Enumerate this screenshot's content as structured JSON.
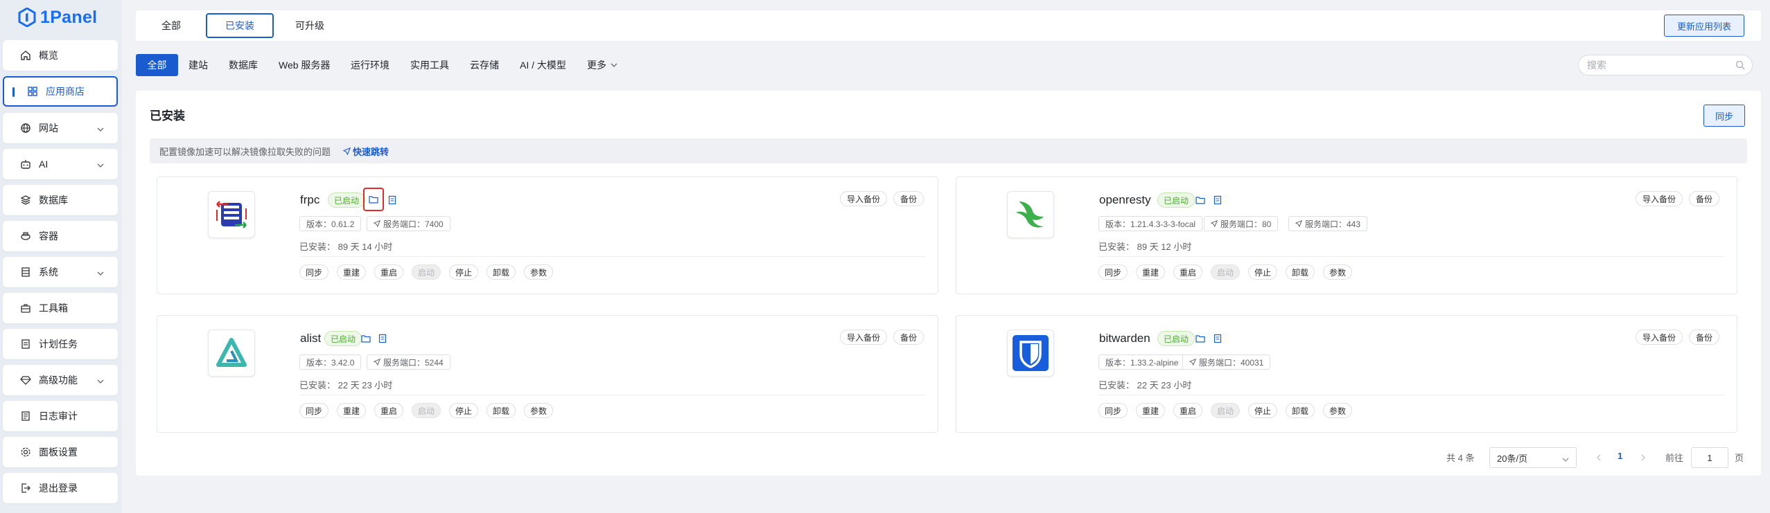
{
  "brand": {
    "name": "1Panel",
    "color": "#1a6df0"
  },
  "sidebar": {
    "items": [
      {
        "label": "概览",
        "icon": "home-icon"
      },
      {
        "label": "应用商店",
        "icon": "grid-icon",
        "active": true
      },
      {
        "label": "网站",
        "icon": "globe-icon",
        "expandable": true
      },
      {
        "label": "AI",
        "icon": "robot-icon",
        "expandable": true
      },
      {
        "label": "数据库",
        "icon": "layers-icon"
      },
      {
        "label": "容器",
        "icon": "container-icon"
      },
      {
        "label": "系统",
        "icon": "server-icon",
        "expandable": true
      },
      {
        "label": "工具箱",
        "icon": "toolbox-icon"
      },
      {
        "label": "计划任务",
        "icon": "calendar-icon"
      },
      {
        "label": "高级功能",
        "icon": "diamond-icon",
        "expandable": true
      },
      {
        "label": "日志审计",
        "icon": "log-icon"
      },
      {
        "label": "面板设置",
        "icon": "gear-icon"
      },
      {
        "label": "退出登录",
        "icon": "logout-icon"
      }
    ]
  },
  "tabs": [
    {
      "label": "全部"
    },
    {
      "label": "已安装",
      "active": true
    },
    {
      "label": "可升级"
    }
  ],
  "update_list_label": "更新应用列表",
  "categories": [
    "全部",
    "建站",
    "数据库",
    "Web 服务器",
    "运行环境",
    "实用工具",
    "云存储",
    "AI / 大模型",
    "更多"
  ],
  "search": {
    "placeholder": "搜索"
  },
  "panel": {
    "title": "已安装",
    "sync_label": "同步",
    "notice": "配置镜像加速可以解决镜像拉取失败的问题",
    "notice_link": "快速跳转"
  },
  "apps": [
    {
      "name": "frpc",
      "status": "已启动",
      "version": "版本：0.61.2",
      "ports": [
        "服务端口：7400"
      ],
      "installed": "已安装：  89 天 14 小时"
    },
    {
      "name": "openresty",
      "status": "已启动",
      "version": "版本：1.21.4.3-3-3-focal",
      "ports": [
        "服务端口：80",
        "服务端口：443"
      ],
      "installed": "已安装：  89 天 12 小时"
    },
    {
      "name": "alist",
      "status": "已启动",
      "version": "版本：3.42.0",
      "ports": [
        "服务端口：5244"
      ],
      "installed": "已安装：  22 天 23 小时"
    },
    {
      "name": "bitwarden",
      "status": "已启动",
      "version": "版本：1.33.2-alpine",
      "ports": [
        "服务端口：40031"
      ],
      "installed": "已安装：  22 天 23 小时"
    }
  ],
  "card_actions": {
    "import_backup": "导入备份",
    "backup": "备份"
  },
  "ops": [
    "同步",
    "重建",
    "重启",
    "启动",
    "停止",
    "卸载",
    "参数"
  ],
  "pagination": {
    "total": "共 4 条",
    "page_size": "20条/页",
    "current": "1",
    "goto": "前往",
    "goto_value": "1",
    "page_unit": "页"
  }
}
